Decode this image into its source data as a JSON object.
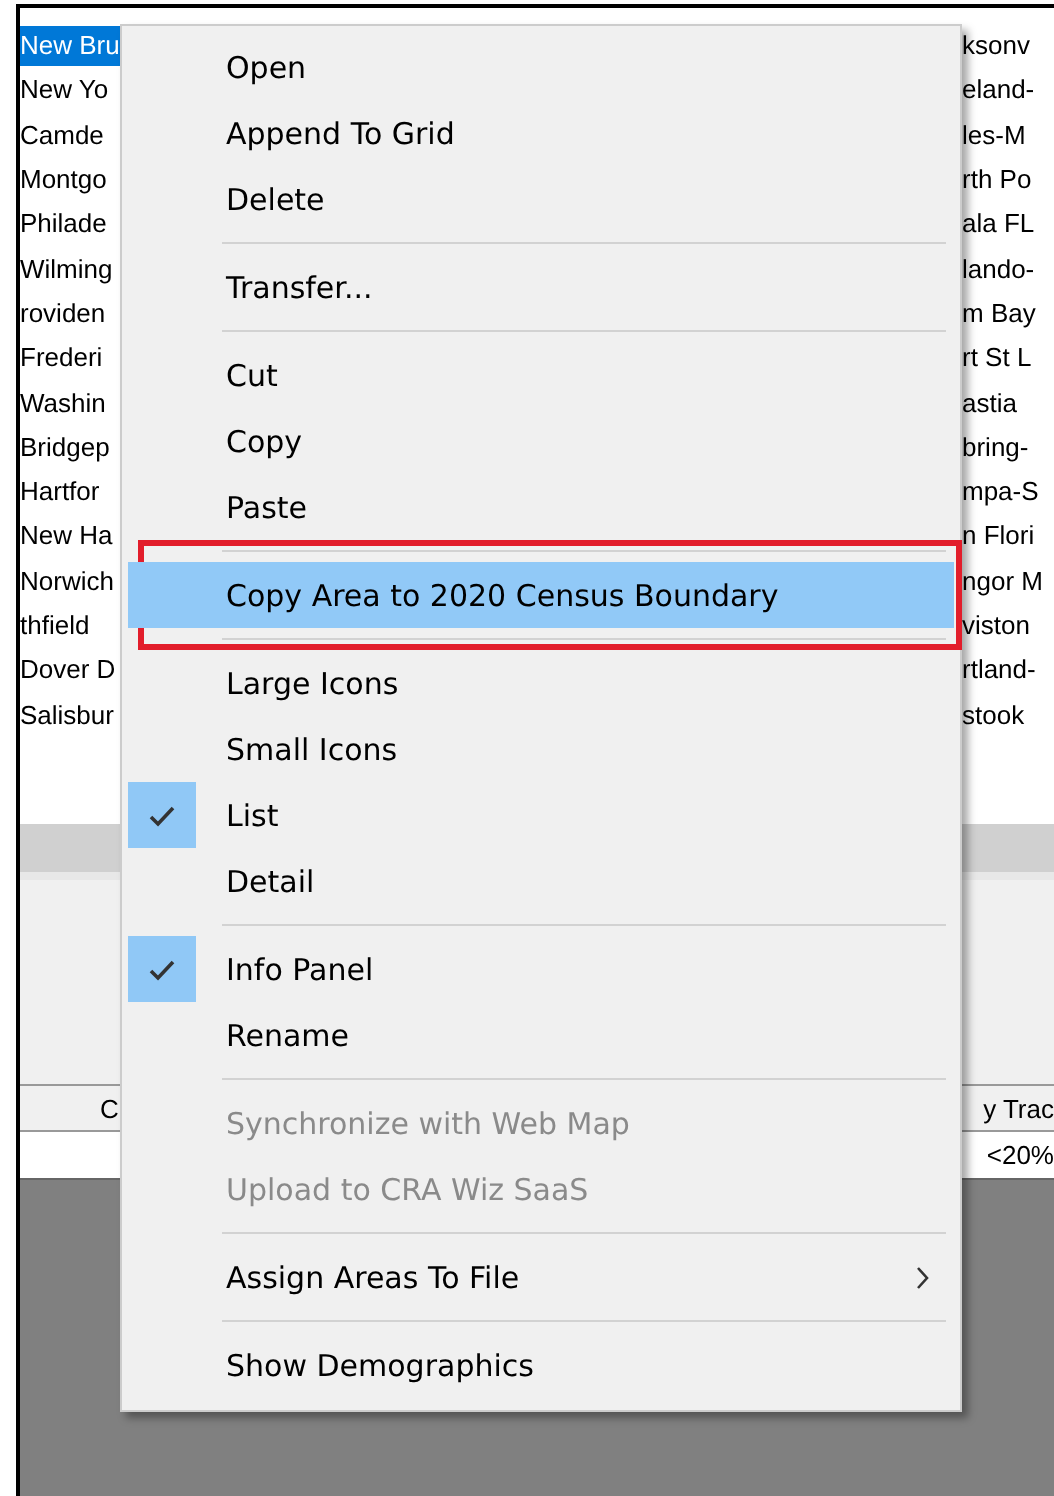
{
  "list": {
    "left_rows": [
      {
        "text": "New Bru",
        "selected": true
      },
      {
        "text": "New Yo",
        "selected": false
      },
      {
        "text": "Camde",
        "selected": false
      },
      {
        "text": "Montgo",
        "selected": false
      },
      {
        "text": "Philade",
        "selected": false
      },
      {
        "text": "Wilming",
        "selected": false
      },
      {
        "text": "roviden",
        "selected": false
      },
      {
        "text": "Frederi",
        "selected": false
      },
      {
        "text": "Washin",
        "selected": false
      },
      {
        "text": "Bridgep",
        "selected": false
      },
      {
        "text": "Hartfor",
        "selected": false
      },
      {
        "text": "New Ha",
        "selected": false
      },
      {
        "text": "Norwich",
        "selected": false
      },
      {
        "text": "thfield",
        "selected": false
      },
      {
        "text": "Dover D",
        "selected": false
      },
      {
        "text": "Salisbur",
        "selected": false
      }
    ],
    "right_rows": [
      "ksonv",
      "eland-",
      "les-M",
      "rth Po",
      "ala FL",
      "lando-",
      "m Bay",
      "rt St L",
      "astia",
      "bring-",
      "mpa-S",
      "n Flori",
      "ngor M",
      "viston",
      "rtland-",
      "stook"
    ]
  },
  "grid": {
    "column_1": "C",
    "column_2": "y Trac",
    "row_value": "<20%"
  },
  "context_menu": [
    {
      "kind": "item",
      "label": "Open",
      "checked": false,
      "disabled": false,
      "selected": false,
      "submenu": false,
      "annotated": false
    },
    {
      "kind": "item",
      "label": "Append To Grid",
      "checked": false,
      "disabled": false,
      "selected": false,
      "submenu": false,
      "annotated": false
    },
    {
      "kind": "item",
      "label": "Delete",
      "checked": false,
      "disabled": false,
      "selected": false,
      "submenu": false,
      "annotated": false
    },
    {
      "kind": "separator"
    },
    {
      "kind": "item",
      "label": "Transfer...",
      "checked": false,
      "disabled": false,
      "selected": false,
      "submenu": false,
      "annotated": false
    },
    {
      "kind": "separator"
    },
    {
      "kind": "item",
      "label": "Cut",
      "checked": false,
      "disabled": false,
      "selected": false,
      "submenu": false,
      "annotated": false
    },
    {
      "kind": "item",
      "label": "Copy",
      "checked": false,
      "disabled": false,
      "selected": false,
      "submenu": false,
      "annotated": false
    },
    {
      "kind": "item",
      "label": "Paste",
      "checked": false,
      "disabled": false,
      "selected": false,
      "submenu": false,
      "annotated": false
    },
    {
      "kind": "separator"
    },
    {
      "kind": "item",
      "label": "Copy Area to 2020 Census Boundary",
      "checked": false,
      "disabled": false,
      "selected": true,
      "submenu": false,
      "annotated": true
    },
    {
      "kind": "separator"
    },
    {
      "kind": "item",
      "label": "Large Icons",
      "checked": false,
      "disabled": false,
      "selected": false,
      "submenu": false,
      "annotated": false
    },
    {
      "kind": "item",
      "label": "Small Icons",
      "checked": false,
      "disabled": false,
      "selected": false,
      "submenu": false,
      "annotated": false
    },
    {
      "kind": "item",
      "label": "List",
      "checked": true,
      "disabled": false,
      "selected": false,
      "submenu": false,
      "annotated": false
    },
    {
      "kind": "item",
      "label": "Detail",
      "checked": false,
      "disabled": false,
      "selected": false,
      "submenu": false,
      "annotated": false
    },
    {
      "kind": "separator"
    },
    {
      "kind": "item",
      "label": "Info Panel",
      "checked": true,
      "disabled": false,
      "selected": false,
      "submenu": false,
      "annotated": false
    },
    {
      "kind": "item",
      "label": "Rename",
      "checked": false,
      "disabled": false,
      "selected": false,
      "submenu": false,
      "annotated": false
    },
    {
      "kind": "separator"
    },
    {
      "kind": "item",
      "label": "Synchronize with Web Map",
      "checked": false,
      "disabled": true,
      "selected": false,
      "submenu": false,
      "annotated": false
    },
    {
      "kind": "item",
      "label": "Upload to CRA Wiz SaaS",
      "checked": false,
      "disabled": true,
      "selected": false,
      "submenu": false,
      "annotated": false
    },
    {
      "kind": "separator"
    },
    {
      "kind": "item",
      "label": "Assign Areas To File",
      "checked": false,
      "disabled": false,
      "selected": false,
      "submenu": true,
      "annotated": false
    },
    {
      "kind": "separator"
    },
    {
      "kind": "item",
      "label": "Show Demographics",
      "checked": false,
      "disabled": false,
      "selected": false,
      "submenu": false,
      "annotated": false
    }
  ]
}
